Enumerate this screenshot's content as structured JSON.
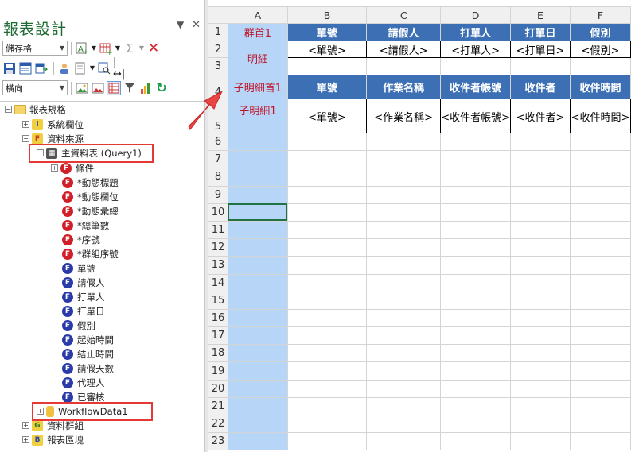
{
  "panel": {
    "title": "報表設計",
    "pin_glyph": "▼",
    "close_glyph": "✕",
    "toolbar": {
      "save_select": "儲存格",
      "orient_select": "橫向"
    }
  },
  "tree": {
    "items": [
      {
        "label": "報表規格"
      },
      {
        "label": "系統欄位"
      },
      {
        "label": "資料來源"
      },
      {
        "label": "主資料表 (Query1)"
      },
      {
        "label": "條件"
      },
      {
        "label": "*動態標題"
      },
      {
        "label": "*動態欄位"
      },
      {
        "label": "*動態彙總"
      },
      {
        "label": "*總筆數"
      },
      {
        "label": "*序號"
      },
      {
        "label": "*群組序號"
      },
      {
        "label": "單號"
      },
      {
        "label": "請假人"
      },
      {
        "label": "打單人"
      },
      {
        "label": "打單日"
      },
      {
        "label": "假別"
      },
      {
        "label": "起始時間"
      },
      {
        "label": "結止時間"
      },
      {
        "label": "請假天數"
      },
      {
        "label": "代理人"
      },
      {
        "label": "已審核"
      },
      {
        "label": "WorkflowData1"
      },
      {
        "label": "資料群組"
      },
      {
        "label": "報表區塊"
      }
    ]
  },
  "sheet": {
    "columns": [
      "A",
      "B",
      "C",
      "D",
      "E",
      "F"
    ],
    "rows": [
      "1",
      "2",
      "3",
      "4",
      "5",
      "6",
      "7",
      "8",
      "9",
      "10",
      "11",
      "12",
      "13",
      "14",
      "15",
      "16",
      "17",
      "18",
      "19",
      "20",
      "21",
      "22",
      "23"
    ],
    "a_labels": {
      "group_head": "群首1",
      "detail": "明細",
      "sub_head": "子明細首1",
      "sub_detail": "子明細1"
    },
    "header1": [
      "單號",
      "請假人",
      "打單人",
      "打單日",
      "假別"
    ],
    "row2": [
      "<單號>",
      "<請假人>",
      "<打單人>",
      "<打單日>",
      "<假別>"
    ],
    "header4": [
      "單號",
      "作業名稱",
      "收件者帳號",
      "收件者",
      "收件時間"
    ],
    "row5": [
      "<單號>",
      "<作業名稱>",
      "<收件者帳號>",
      "<收件者>",
      "<收件時間>"
    ]
  },
  "colors": {
    "accent_header": "#3c6fb4",
    "band_column": "#b7d6f7",
    "highlight": "#e53935"
  }
}
